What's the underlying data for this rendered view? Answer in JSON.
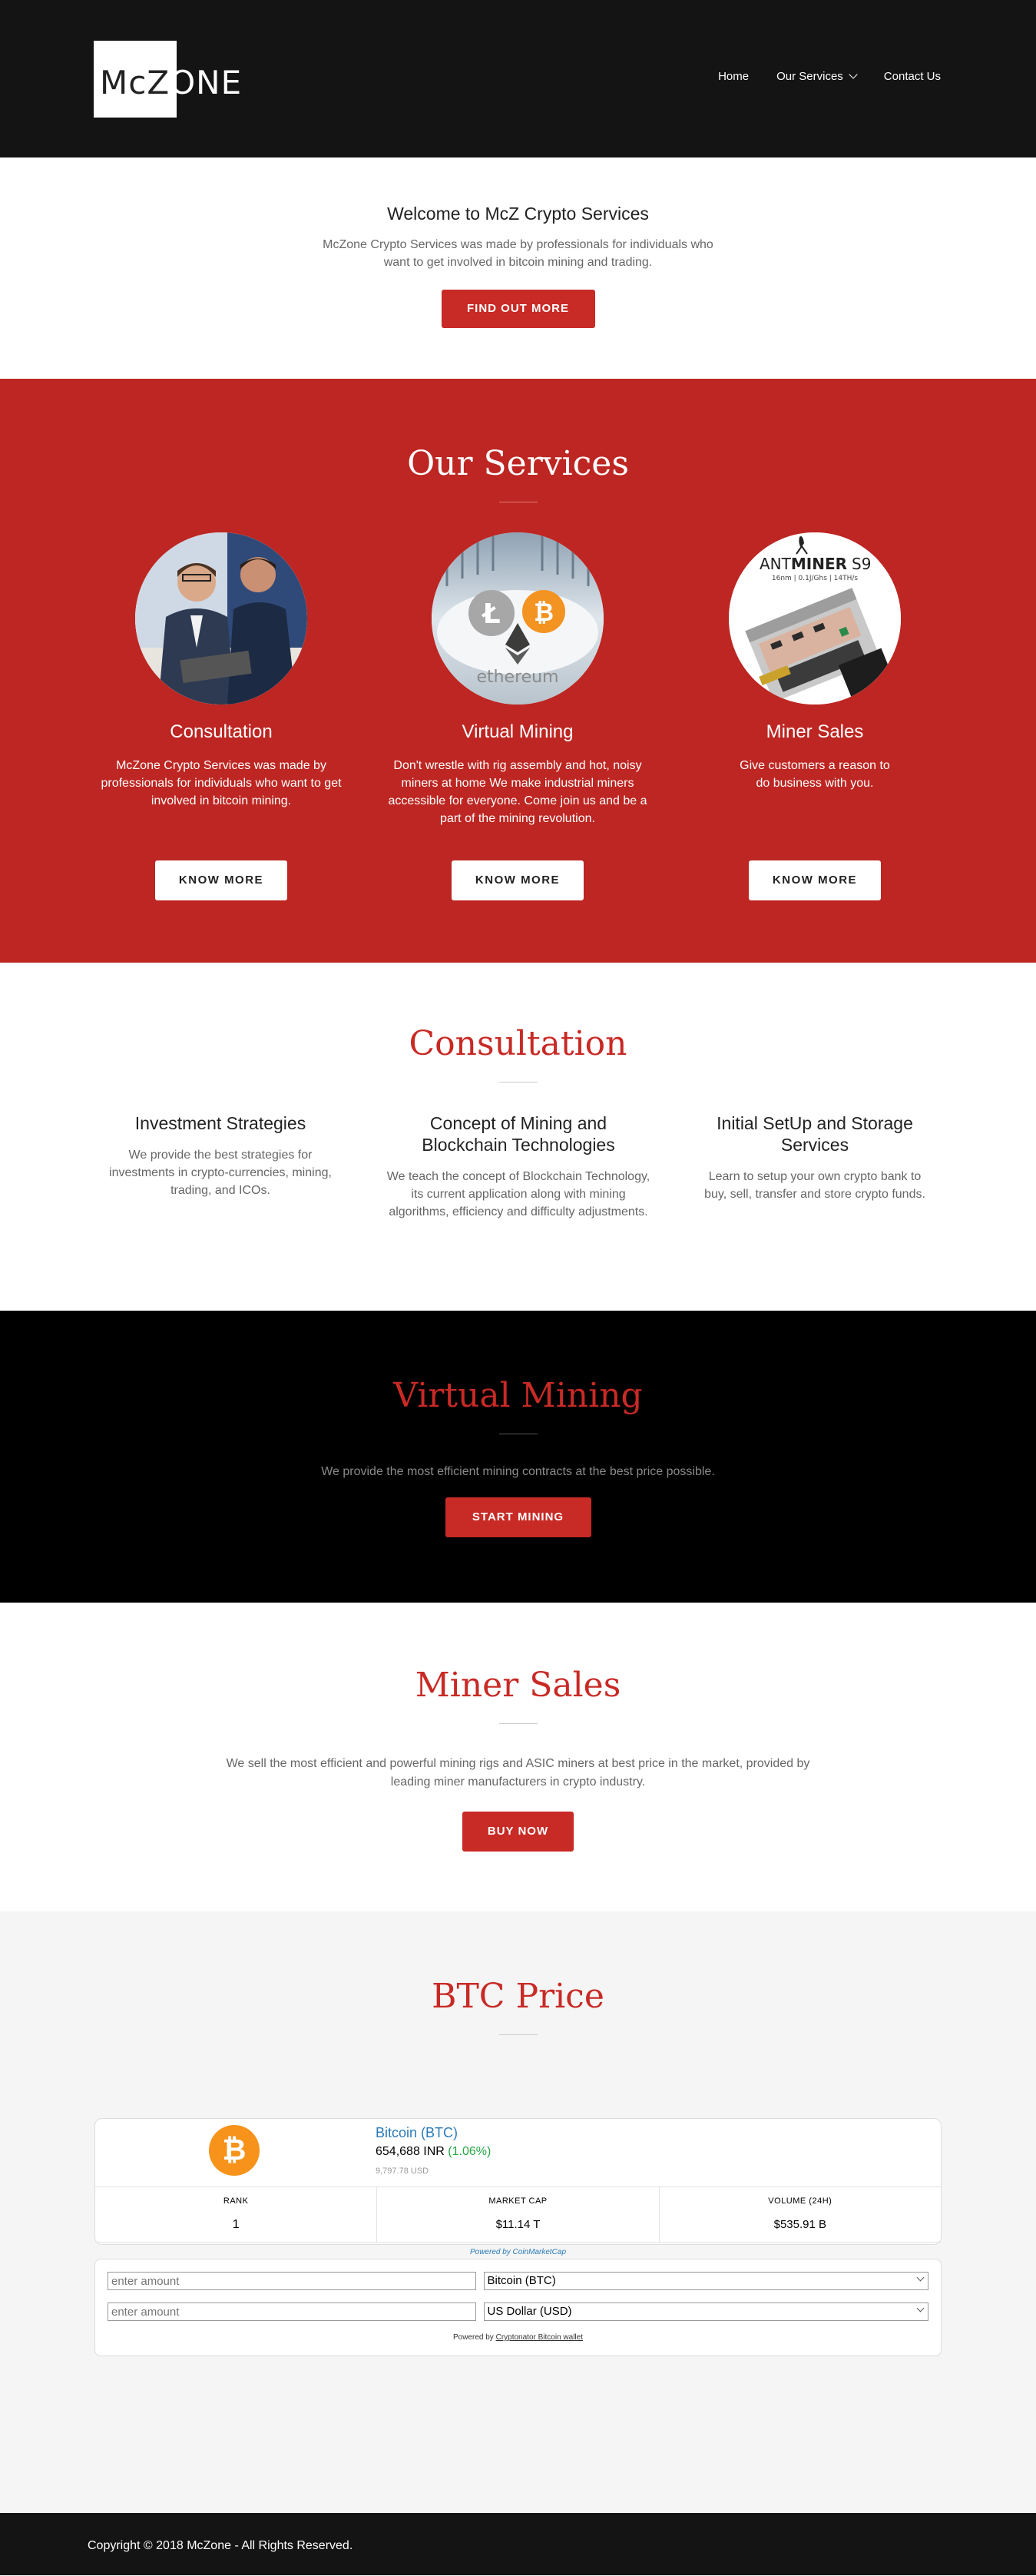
{
  "header": {
    "logo_alt": "McZONE",
    "nav": [
      {
        "label": "Home"
      },
      {
        "label": "Our Services"
      },
      {
        "label": "Contact Us"
      }
    ]
  },
  "welcome": {
    "title": "Welcome to McZ Crypto Services",
    "text": "McZone Crypto Services was made by professionals for individuals who want to get involved in bitcoin mining and trading.",
    "button": "FIND OUT MORE"
  },
  "services": {
    "title": "Our Services",
    "items": [
      {
        "title": "Consultation",
        "text": "McZone Crypto Services was made by professionals for individuals who want to get involved in bitcoin mining.",
        "button": "KNOW MORE"
      },
      {
        "title": "Virtual Mining",
        "text": "Don't wrestle with rig assembly and hot, noisy miners at home We make industrial miners accessible for everyone. Come join us and be a part of the mining revolution.",
        "button": "KNOW MORE"
      },
      {
        "title": "Miner Sales",
        "text": "Give customers a reason to do business with you.",
        "button": "KNOW MORE"
      }
    ],
    "antminer": {
      "brand_a": "ANT",
      "brand_b": "MINER",
      "model": "S9",
      "spec": "16nm  |  0.1J/Ghs  |  14TH/s"
    },
    "ethereum": "ethereum"
  },
  "consultation": {
    "title": "Consultation",
    "items": [
      {
        "title": "Investment Strategies",
        "text": "We provide the best strategies for investments in crypto-currencies, mining, trading, and ICOs."
      },
      {
        "title": "Concept of Mining and Blockchain Technologies",
        "text": "We teach the concept of Blockchain Technology, its current application along with mining algorithms, efficiency and difficulty adjustments."
      },
      {
        "title": "Initial SetUp and Storage Services",
        "text": "Learn to setup your own crypto bank to buy, sell, transfer and store crypto funds."
      }
    ]
  },
  "virtual_mining": {
    "title": "Virtual Mining",
    "text": "We provide the most efficient mining contracts at the best price possible.",
    "button": "START MINING"
  },
  "miner_sales": {
    "title": "Miner Sales",
    "text": "We sell the most efficient and powerful mining rigs and ASIC miners at best price in the market, provided by leading miner manufacturers in crypto industry.",
    "button": "BUY NOW"
  },
  "btc": {
    "title": "BTC Price",
    "coin_name": "Bitcoin (BTC)",
    "price": "654,688 INR",
    "change": "(1.06%)",
    "usd": "9,797.78 USD",
    "stats": [
      {
        "label": "RANK",
        "value": "1"
      },
      {
        "label": "MARKET CAP",
        "value": "$11.14 T"
      },
      {
        "label": "VOLUME (24H)",
        "value": "$535.91 B"
      }
    ],
    "powered_cmc": "Powered by CoinMarketCap",
    "converter": {
      "placeholder": "enter amount",
      "from": "Bitcoin (BTC)",
      "to": "US Dollar (USD)",
      "powered_prefix": "Powered by ",
      "powered_link": "Cryptonator Bitcoin wallet"
    }
  },
  "footer": {
    "copyright": "Copyright © 2018 McZone - All Rights Reserved."
  },
  "colors": {
    "primary_red": "#bd2622",
    "button_red": "#c82a25",
    "dark": "#141414",
    "bitcoin_orange": "#f7931a"
  }
}
